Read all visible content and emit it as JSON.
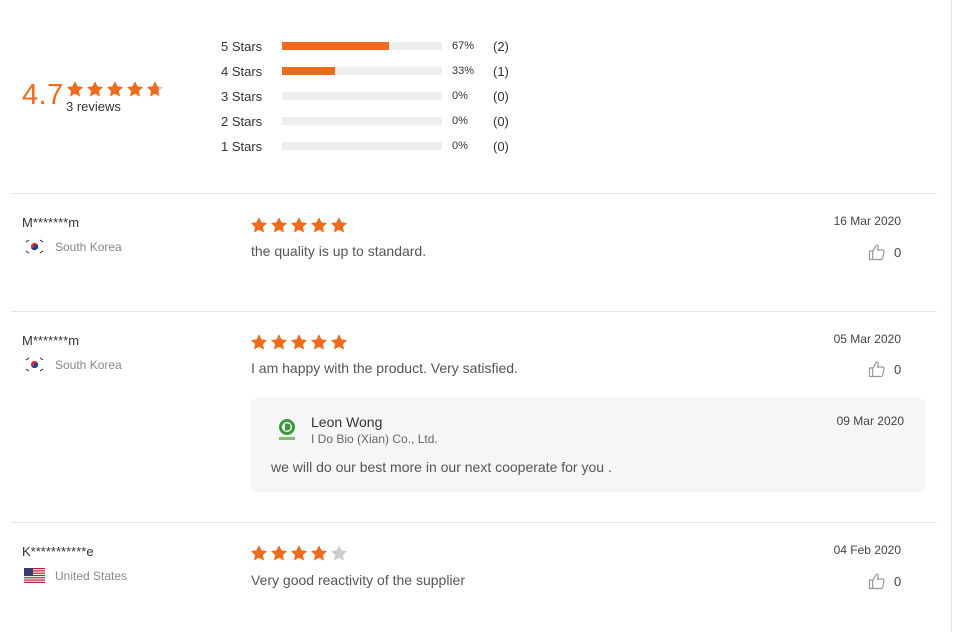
{
  "summary": {
    "score": "4.7",
    "rating_fraction": 0.94,
    "reviews_count": "3 reviews",
    "distribution": [
      {
        "label": "5  Stars",
        "percent": 67,
        "pct_text": "67%",
        "count": "(2)"
      },
      {
        "label": "4  Stars",
        "percent": 33,
        "pct_text": "33%",
        "count": "(1)"
      },
      {
        "label": "3  Stars",
        "percent": 0,
        "pct_text": "0%",
        "count": "(0)"
      },
      {
        "label": "2  Stars",
        "percent": 0,
        "pct_text": "0%",
        "count": "(0)"
      },
      {
        "label": "1  Stars",
        "percent": 0,
        "pct_text": "0%",
        "count": "(0)"
      }
    ]
  },
  "reviews": [
    {
      "name": "M*******m",
      "country": "South Korea",
      "flag": "south-korea-flag",
      "stars": 5,
      "text": "the quality is up to standard.",
      "date": "16 Mar 2020",
      "likes": "0"
    },
    {
      "name": "M*******m",
      "country": "South Korea",
      "flag": "south-korea-flag",
      "stars": 5,
      "text": "I am happy with the product. Very satisfied.",
      "date": "05 Mar 2020",
      "likes": "0",
      "reply": {
        "name": "Leon Wong",
        "company": "I Do Bio (Xian) Co., Ltd.",
        "date": "09 Mar 2020",
        "text": "we will do our best more in our next cooperate for you ."
      }
    },
    {
      "name": "K***********e",
      "country": "United States",
      "flag": "united-states-flag",
      "stars": 4,
      "text": "Very good reactivity of the supplier",
      "date": "04 Feb 2020",
      "likes": "0"
    }
  ],
  "colors": {
    "accent": "#f06a1d",
    "star_empty": "#cccccc",
    "bar_track": "#eeeeee",
    "reply_bg": "#f5f6f7"
  },
  "icons": {
    "star": "star-icon",
    "like": "thumbs-up-icon",
    "supplier_logo": "supplier-logo-icon"
  }
}
